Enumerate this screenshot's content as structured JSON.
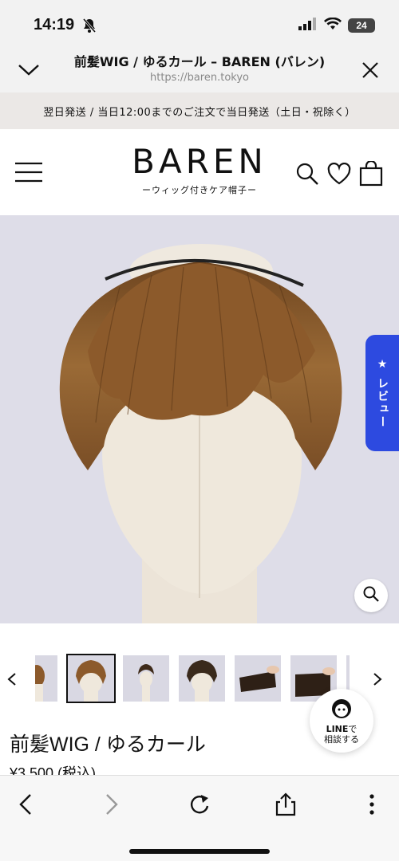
{
  "status": {
    "time": "14:19",
    "battery": "24"
  },
  "browser": {
    "title": "前髪WIG / ゆるカール – BAREN (バレン)",
    "url": "https://baren.tokyo"
  },
  "announcement": "翌日発送 / 当日12:00までのご注文で当日発送（土日・祝除く）",
  "site": {
    "logo": "BAREN",
    "tagline": "ーウィッグ付きケア帽子ー"
  },
  "review_tab": "★ レビュー",
  "thumbnails": {
    "count": 7,
    "selected_index": 1
  },
  "line_button": {
    "brand": "LINE",
    "suffix": "で",
    "line2": "相談する"
  },
  "product": {
    "title": "前髪WIG / ゆるカール",
    "price": "¥3,500 (税込)"
  },
  "colors": {
    "accent_blue": "#2d4ae0",
    "hair_brown": "#8a5a2e",
    "announcement_bg": "#ebe8e6"
  },
  "icons": [
    "bell-slash-icon",
    "signal-icon",
    "wifi-icon",
    "chevron-down-icon",
    "close-icon",
    "menu-icon",
    "search-icon",
    "heart-icon",
    "bag-icon",
    "zoom-icon",
    "back-icon",
    "forward-icon",
    "reload-icon",
    "share-icon",
    "more-icon"
  ]
}
